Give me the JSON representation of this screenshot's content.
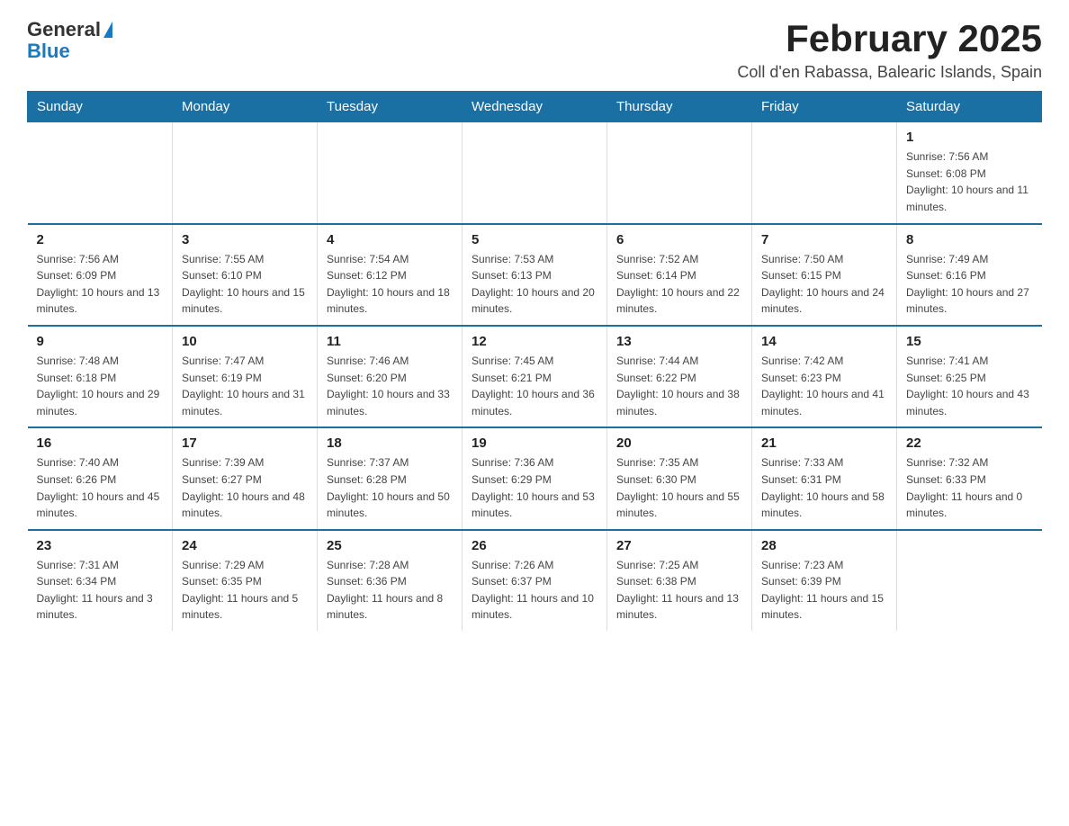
{
  "header": {
    "logo_general": "General",
    "logo_blue": "Blue",
    "month_title": "February 2025",
    "location": "Coll d'en Rabassa, Balearic Islands, Spain"
  },
  "days_of_week": [
    "Sunday",
    "Monday",
    "Tuesday",
    "Wednesday",
    "Thursday",
    "Friday",
    "Saturday"
  ],
  "weeks": [
    [
      {
        "day": "",
        "sunrise": "",
        "sunset": "",
        "daylight": ""
      },
      {
        "day": "",
        "sunrise": "",
        "sunset": "",
        "daylight": ""
      },
      {
        "day": "",
        "sunrise": "",
        "sunset": "",
        "daylight": ""
      },
      {
        "day": "",
        "sunrise": "",
        "sunset": "",
        "daylight": ""
      },
      {
        "day": "",
        "sunrise": "",
        "sunset": "",
        "daylight": ""
      },
      {
        "day": "",
        "sunrise": "",
        "sunset": "",
        "daylight": ""
      },
      {
        "day": "1",
        "sunrise": "Sunrise: 7:56 AM",
        "sunset": "Sunset: 6:08 PM",
        "daylight": "Daylight: 10 hours and 11 minutes."
      }
    ],
    [
      {
        "day": "2",
        "sunrise": "Sunrise: 7:56 AM",
        "sunset": "Sunset: 6:09 PM",
        "daylight": "Daylight: 10 hours and 13 minutes."
      },
      {
        "day": "3",
        "sunrise": "Sunrise: 7:55 AM",
        "sunset": "Sunset: 6:10 PM",
        "daylight": "Daylight: 10 hours and 15 minutes."
      },
      {
        "day": "4",
        "sunrise": "Sunrise: 7:54 AM",
        "sunset": "Sunset: 6:12 PM",
        "daylight": "Daylight: 10 hours and 18 minutes."
      },
      {
        "day": "5",
        "sunrise": "Sunrise: 7:53 AM",
        "sunset": "Sunset: 6:13 PM",
        "daylight": "Daylight: 10 hours and 20 minutes."
      },
      {
        "day": "6",
        "sunrise": "Sunrise: 7:52 AM",
        "sunset": "Sunset: 6:14 PM",
        "daylight": "Daylight: 10 hours and 22 minutes."
      },
      {
        "day": "7",
        "sunrise": "Sunrise: 7:50 AM",
        "sunset": "Sunset: 6:15 PM",
        "daylight": "Daylight: 10 hours and 24 minutes."
      },
      {
        "day": "8",
        "sunrise": "Sunrise: 7:49 AM",
        "sunset": "Sunset: 6:16 PM",
        "daylight": "Daylight: 10 hours and 27 minutes."
      }
    ],
    [
      {
        "day": "9",
        "sunrise": "Sunrise: 7:48 AM",
        "sunset": "Sunset: 6:18 PM",
        "daylight": "Daylight: 10 hours and 29 minutes."
      },
      {
        "day": "10",
        "sunrise": "Sunrise: 7:47 AM",
        "sunset": "Sunset: 6:19 PM",
        "daylight": "Daylight: 10 hours and 31 minutes."
      },
      {
        "day": "11",
        "sunrise": "Sunrise: 7:46 AM",
        "sunset": "Sunset: 6:20 PM",
        "daylight": "Daylight: 10 hours and 33 minutes."
      },
      {
        "day": "12",
        "sunrise": "Sunrise: 7:45 AM",
        "sunset": "Sunset: 6:21 PM",
        "daylight": "Daylight: 10 hours and 36 minutes."
      },
      {
        "day": "13",
        "sunrise": "Sunrise: 7:44 AM",
        "sunset": "Sunset: 6:22 PM",
        "daylight": "Daylight: 10 hours and 38 minutes."
      },
      {
        "day": "14",
        "sunrise": "Sunrise: 7:42 AM",
        "sunset": "Sunset: 6:23 PM",
        "daylight": "Daylight: 10 hours and 41 minutes."
      },
      {
        "day": "15",
        "sunrise": "Sunrise: 7:41 AM",
        "sunset": "Sunset: 6:25 PM",
        "daylight": "Daylight: 10 hours and 43 minutes."
      }
    ],
    [
      {
        "day": "16",
        "sunrise": "Sunrise: 7:40 AM",
        "sunset": "Sunset: 6:26 PM",
        "daylight": "Daylight: 10 hours and 45 minutes."
      },
      {
        "day": "17",
        "sunrise": "Sunrise: 7:39 AM",
        "sunset": "Sunset: 6:27 PM",
        "daylight": "Daylight: 10 hours and 48 minutes."
      },
      {
        "day": "18",
        "sunrise": "Sunrise: 7:37 AM",
        "sunset": "Sunset: 6:28 PM",
        "daylight": "Daylight: 10 hours and 50 minutes."
      },
      {
        "day": "19",
        "sunrise": "Sunrise: 7:36 AM",
        "sunset": "Sunset: 6:29 PM",
        "daylight": "Daylight: 10 hours and 53 minutes."
      },
      {
        "day": "20",
        "sunrise": "Sunrise: 7:35 AM",
        "sunset": "Sunset: 6:30 PM",
        "daylight": "Daylight: 10 hours and 55 minutes."
      },
      {
        "day": "21",
        "sunrise": "Sunrise: 7:33 AM",
        "sunset": "Sunset: 6:31 PM",
        "daylight": "Daylight: 10 hours and 58 minutes."
      },
      {
        "day": "22",
        "sunrise": "Sunrise: 7:32 AM",
        "sunset": "Sunset: 6:33 PM",
        "daylight": "Daylight: 11 hours and 0 minutes."
      }
    ],
    [
      {
        "day": "23",
        "sunrise": "Sunrise: 7:31 AM",
        "sunset": "Sunset: 6:34 PM",
        "daylight": "Daylight: 11 hours and 3 minutes."
      },
      {
        "day": "24",
        "sunrise": "Sunrise: 7:29 AM",
        "sunset": "Sunset: 6:35 PM",
        "daylight": "Daylight: 11 hours and 5 minutes."
      },
      {
        "day": "25",
        "sunrise": "Sunrise: 7:28 AM",
        "sunset": "Sunset: 6:36 PM",
        "daylight": "Daylight: 11 hours and 8 minutes."
      },
      {
        "day": "26",
        "sunrise": "Sunrise: 7:26 AM",
        "sunset": "Sunset: 6:37 PM",
        "daylight": "Daylight: 11 hours and 10 minutes."
      },
      {
        "day": "27",
        "sunrise": "Sunrise: 7:25 AM",
        "sunset": "Sunset: 6:38 PM",
        "daylight": "Daylight: 11 hours and 13 minutes."
      },
      {
        "day": "28",
        "sunrise": "Sunrise: 7:23 AM",
        "sunset": "Sunset: 6:39 PM",
        "daylight": "Daylight: 11 hours and 15 minutes."
      },
      {
        "day": "",
        "sunrise": "",
        "sunset": "",
        "daylight": ""
      }
    ]
  ]
}
